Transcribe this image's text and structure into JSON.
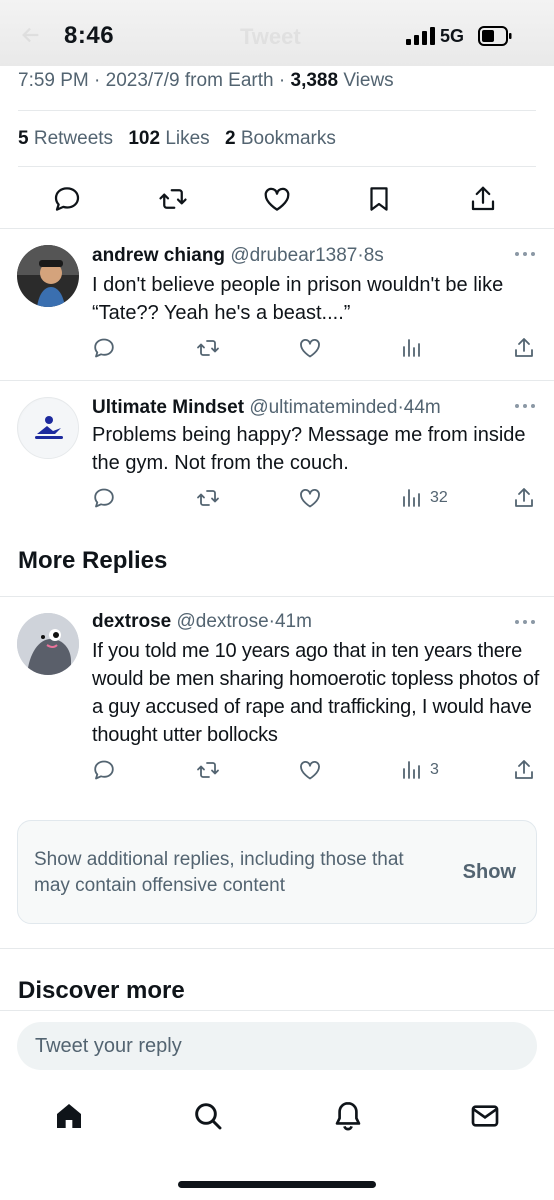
{
  "status_bar": {
    "time": "8:46",
    "network": "5G"
  },
  "header": {
    "title": "Tweet"
  },
  "tweet_meta": {
    "time": "7:59 PM",
    "date": "2023/7/9",
    "source": "from Earth",
    "views_count": "3,388",
    "views_label": "Views"
  },
  "tweet_stats": {
    "retweets_count": "5",
    "retweets_label": "Retweets",
    "likes_count": "102",
    "likes_label": "Likes",
    "bookmarks_count": "2",
    "bookmarks_label": "Bookmarks"
  },
  "tweet_actions": [
    "reply-icon",
    "retweet-icon",
    "like-icon",
    "bookmark-icon",
    "share-icon"
  ],
  "replies": [
    {
      "name": "andrew chiang",
      "handle": "@drubear1387",
      "time": "8s",
      "text": "I don't believe people in prison wouldn't be like “Tate?? Yeah he's a beast....”",
      "views": ""
    },
    {
      "name": "Ultimate Mindset",
      "handle": "@ultimateminded",
      "time": "44m",
      "text": "Problems being happy? Message me from inside the gym. Not from the couch.",
      "views": "32"
    }
  ],
  "more_replies": {
    "title": "More Replies",
    "items": [
      {
        "name": "dextrose",
        "handle": "@dextrose",
        "time": "41m",
        "text": "If you told me 10 years ago that in ten years there would be men sharing homoerotic topless photos of a guy accused of rape and trafficking, I would have thought utter bollocks",
        "views": "3"
      }
    ]
  },
  "show_more": {
    "text": "Show additional replies, including those that may contain offensive content",
    "button": "Show"
  },
  "discover": {
    "title": "Discover more"
  },
  "reply_input": {
    "placeholder": "Tweet your reply",
    "value": ""
  },
  "tab_bar": [
    "home-icon",
    "search-icon",
    "notifications-icon",
    "messages-icon"
  ],
  "colors": {
    "text": "#0f1419",
    "secondary": "#536471",
    "divider": "#e6e9eb"
  }
}
